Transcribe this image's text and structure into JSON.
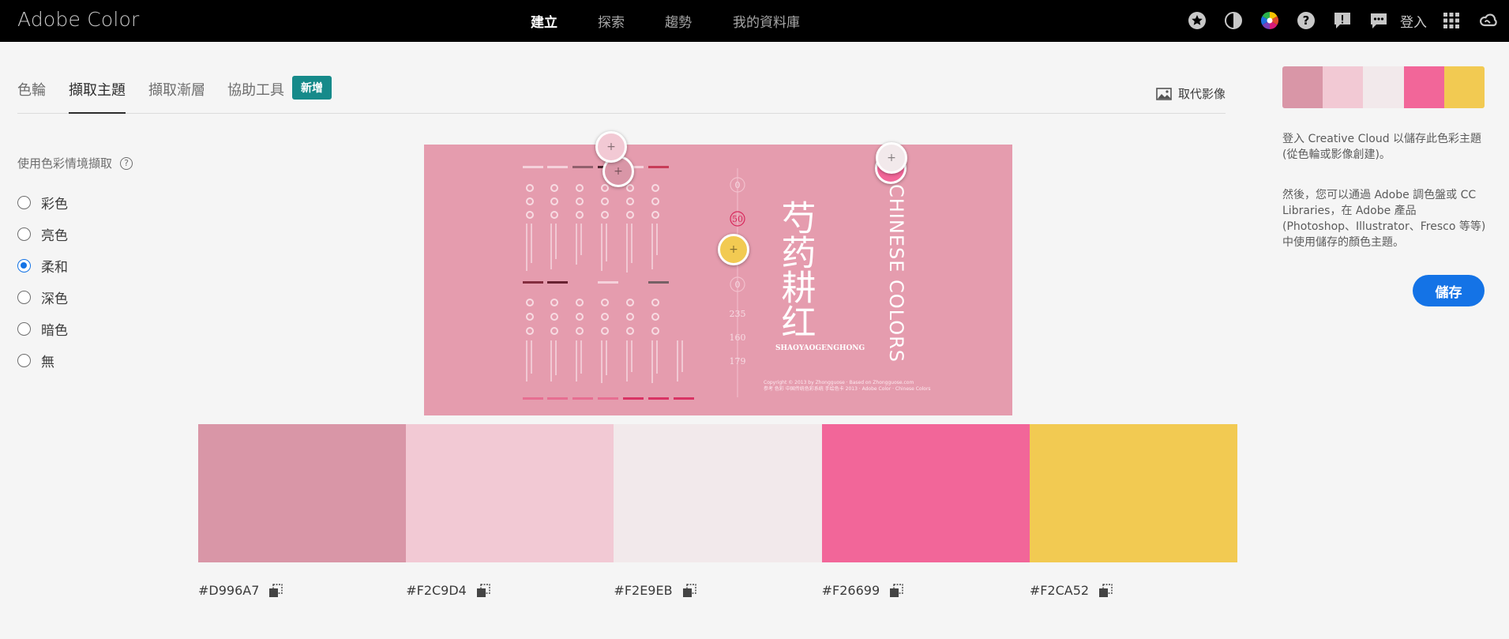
{
  "app": {
    "title": "Adobe Color"
  },
  "nav": {
    "items": [
      {
        "label": "建立",
        "active": true
      },
      {
        "label": "探索",
        "active": false
      },
      {
        "label": "趨勢",
        "active": false
      },
      {
        "label": "我的資料庫",
        "active": false
      }
    ],
    "sign_in": "登入",
    "icons": [
      "star-icon",
      "contrast-icon",
      "color-wheel-icon",
      "help-icon",
      "feedback-icon",
      "chat-icon",
      "apps-grid-icon",
      "creative-cloud-icon"
    ]
  },
  "subtabs": {
    "items": [
      {
        "label": "色輪",
        "active": false
      },
      {
        "label": "擷取主題",
        "active": true
      },
      {
        "label": "擷取漸層",
        "active": false
      },
      {
        "label": "協助工具",
        "active": false
      }
    ],
    "new_badge": "新增",
    "replace_image": "取代影像"
  },
  "mood": {
    "label": "使用色彩情境擷取",
    "help": "?",
    "options": [
      {
        "label": "彩色",
        "selected": false
      },
      {
        "label": "亮色",
        "selected": false
      },
      {
        "label": "柔和",
        "selected": true
      },
      {
        "label": "深色",
        "selected": false
      },
      {
        "label": "暗色",
        "selected": false
      },
      {
        "label": "無",
        "selected": false
      }
    ]
  },
  "image": {
    "title_cn": "芍药耕红",
    "title_en": "CHINESE COLORS",
    "subtitle": "SHAOYAOGENGHONG",
    "values": [
      "0",
      "50",
      "0",
      "235",
      "160",
      "179"
    ],
    "copyright_1": "Copyright © 2013 by Zhongguose · Based on Zhongguose.com",
    "copyright_2": "参考 色彩 中国传统色彩系统 手绘色卡 2013 · Adobe Color · Chinese Colors"
  },
  "palette": {
    "swatches": [
      {
        "hex": "#D996A7",
        "color": "#D996A7"
      },
      {
        "hex": "#F2C9D4",
        "color": "#F2C9D4"
      },
      {
        "hex": "#F2E9EB",
        "color": "#F2E9EB"
      },
      {
        "hex": "#F26699",
        "color": "#F26699"
      },
      {
        "hex": "#F2CA52",
        "color": "#F2CA52"
      }
    ]
  },
  "side": {
    "text1": "登入 Creative Cloud 以儲存此色彩主題 (從色輪或影像創建)。",
    "text2": "然後，您可以通過 Adobe 調色盤或 CC Libraries，在 Adobe 產品 (Photoshop、Illustrator、Fresco 等等) 中使用儲存的顏色主題。",
    "save": "儲存"
  },
  "colors": {
    "accent": "#1473E6",
    "badge": "#168A8A",
    "topbar": "#000000"
  }
}
